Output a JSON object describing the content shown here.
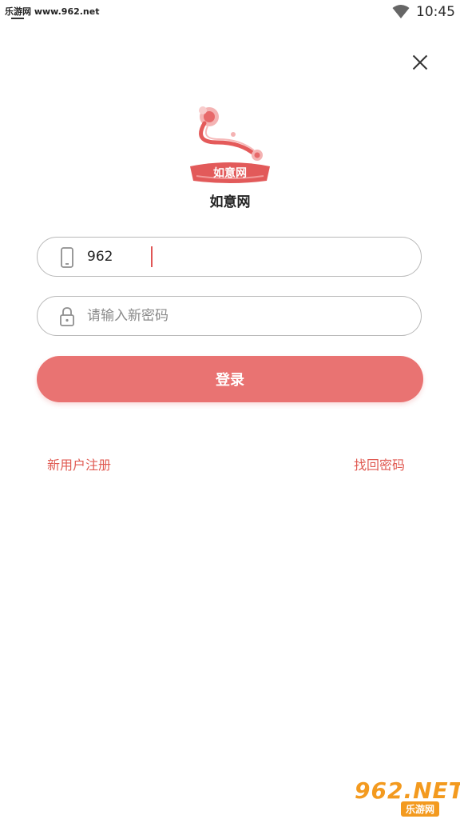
{
  "status_bar": {
    "watermark": "乐游网 www.962.net",
    "time": "10:45",
    "wifi_icon": "wifi-icon"
  },
  "header": {
    "close_icon": "close-icon",
    "logo_text": "如意网",
    "app_name": "如意网"
  },
  "form": {
    "phone": {
      "icon": "phone-icon",
      "value": "962"
    },
    "password": {
      "icon": "lock-icon",
      "placeholder": "请输入新密码"
    },
    "login_label": "登录"
  },
  "links": {
    "register": "新用户注册",
    "forgot": "找回密码"
  },
  "watermark": {
    "brand": "962.NET",
    "sub": "乐游网"
  },
  "colors": {
    "accent": "#e97372",
    "link": "#e05a52",
    "border": "#b9b9b9"
  }
}
